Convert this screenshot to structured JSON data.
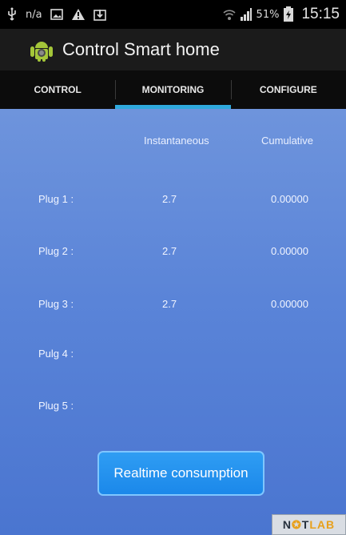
{
  "status_bar": {
    "icons_left": [
      "usb-icon",
      "sim-icon",
      "image-icon",
      "warning-icon",
      "download-icon"
    ],
    "na_text": "n/a",
    "icons_right": [
      "wifi-icon",
      "signal-icon",
      "battery-icon"
    ],
    "battery_text": "51%",
    "time": "15:15"
  },
  "action_bar": {
    "title": "Control Smart home",
    "icon": "android-icon"
  },
  "tabs": [
    {
      "label": "CONTROL",
      "active": false
    },
    {
      "label": "MONITORING",
      "active": true
    },
    {
      "label": "CONFIGURE",
      "active": false
    }
  ],
  "monitoring": {
    "headers": {
      "instantaneous": "Instantaneous",
      "cumulative": "Cumulative"
    },
    "rows": [
      {
        "label": "Plug 1 :",
        "instantaneous": "2.7",
        "cumulative": "0.00000"
      },
      {
        "label": "Plug 2 :",
        "instantaneous": "2.7",
        "cumulative": "0.00000"
      },
      {
        "label": "Plug 3 :",
        "instantaneous": "2.7",
        "cumulative": "0.00000"
      },
      {
        "label": "Pulg 4 :",
        "instantaneous": "",
        "cumulative": ""
      },
      {
        "label": "Plug 5 :",
        "instantaneous": "",
        "cumulative": ""
      }
    ],
    "button_label": "Realtime consumption"
  },
  "watermark": {
    "text_a": "N",
    "text_b": "T",
    "text_c": "LAB"
  },
  "colors": {
    "tab_indicator": "#2fa9dd",
    "content_bg": "#5a84d8",
    "button": "#1b88ea"
  }
}
